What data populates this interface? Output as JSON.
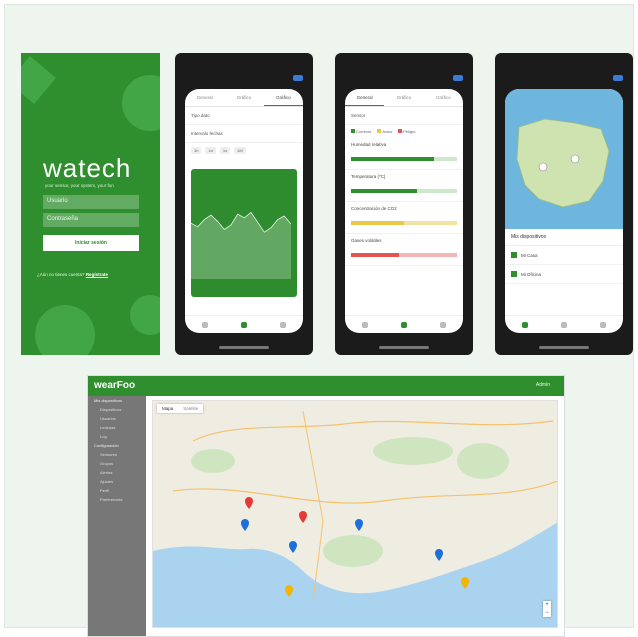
{
  "login": {
    "brand": "watech",
    "tagline": "your sensor, your system, your fun",
    "user_placeholder": "Usuario",
    "password_placeholder": "Contraseña",
    "login_button": "Iniciar sesión",
    "register_prompt": "¿Aún no tienes cuenta?",
    "register_link": "Regístrate"
  },
  "phone_chart": {
    "tabs": [
      "General",
      "Gráfico",
      "Gráfico"
    ],
    "active_tab": 2,
    "fields": [
      "Tipo dato",
      "Intervalo fechas"
    ],
    "ranges": [
      "1h",
      "1d",
      "1s",
      "1M"
    ],
    "series": [
      0.62,
      0.58,
      0.66,
      0.71,
      0.64,
      0.55,
      0.6,
      0.72,
      0.68,
      0.74,
      0.63,
      0.52,
      0.57,
      0.66,
      0.7,
      0.61
    ]
  },
  "phone_sensors": {
    "tabs": [
      "General",
      "Gráfico",
      "Gráfico"
    ],
    "device": "Sensor",
    "legend": [
      "Correcto",
      "Aviso",
      "Peligro"
    ],
    "sensors": [
      {
        "label": "Humedad relativa",
        "level": 0.78,
        "state": "ok"
      },
      {
        "label": "Temperatura (ºC)",
        "level": 0.62,
        "state": "ok"
      },
      {
        "label": "Concentración de CO2",
        "level": 0.5,
        "state": "warn"
      },
      {
        "label": "Gases volátiles",
        "level": 0.45,
        "state": "bad"
      }
    ]
  },
  "phone_map": {
    "devices_title": "Mis dispositivos",
    "devices": [
      "Mi Casa",
      "Mi Oficina"
    ]
  },
  "web": {
    "logo": "wearFoo",
    "user": "Admin",
    "sidebar": [
      "Mis dispositivos",
      "Dispositivos",
      "Usuarios",
      "Lecturas",
      "Log",
      "Configuración",
      "Sensores",
      "Grupos",
      "Alertas",
      "Ajustes",
      "Perfil",
      "Preferencias"
    ],
    "map_tabs": [
      "Mapa",
      "Satélite"
    ],
    "markers": [
      {
        "color": "#e53935"
      },
      {
        "color": "#1e6fd9"
      },
      {
        "color": "#e53935"
      },
      {
        "color": "#1e6fd9"
      },
      {
        "color": "#1e6fd9"
      },
      {
        "color": "#1e6fd9"
      },
      {
        "color": "#f4b400"
      },
      {
        "color": "#f4b400"
      }
    ]
  },
  "colors": {
    "accent": "#2f8f2f",
    "map_water": "#8fc9ee"
  }
}
